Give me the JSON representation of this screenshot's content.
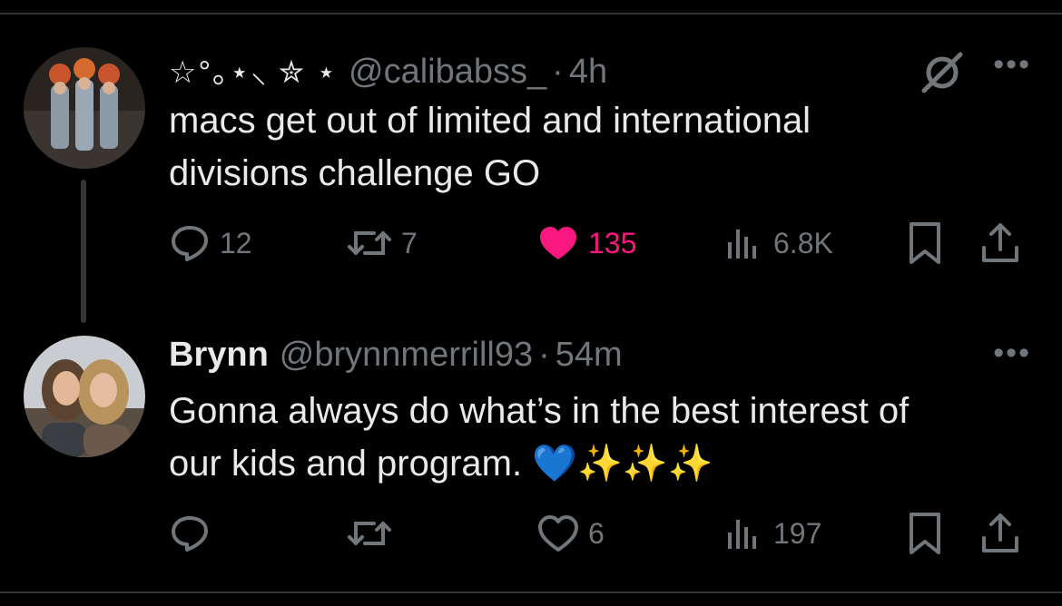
{
  "colors": {
    "background": "#000000",
    "text": "#e7e9ea",
    "muted": "#71767b",
    "divider": "#2f3336",
    "like_active": "#f91880"
  },
  "tweets": [
    {
      "display_name": "☆°｡⋆⸜ ✮ ⋆",
      "handle": "@calibabss_",
      "separator": "·",
      "time": "4h",
      "text_line1": "macs get out of limited and international",
      "text_line2": "divisions challenge GO",
      "reply_count": "12",
      "repost_count": "7",
      "like_count": "135",
      "liked": true,
      "views": "6.8K",
      "more": "•••",
      "icons": [
        "grok-icon",
        "more-icon",
        "reply-icon",
        "repost-icon",
        "heart-filled-icon",
        "views-icon",
        "bookmark-icon",
        "share-icon"
      ]
    },
    {
      "display_name": "Brynn",
      "handle": "@brynnmerrill93",
      "separator": "·",
      "time": "54m",
      "text_line1": "Gonna always do what’s in the best interest of",
      "text_line2": "our kids and program. 💙✨✨✨",
      "reply_count": "",
      "repost_count": "",
      "like_count": "6",
      "liked": false,
      "views": "197",
      "more": "•••",
      "icons": [
        "more-icon",
        "reply-icon",
        "repost-icon",
        "heart-outline-icon",
        "views-icon",
        "bookmark-icon",
        "share-icon"
      ]
    }
  ]
}
